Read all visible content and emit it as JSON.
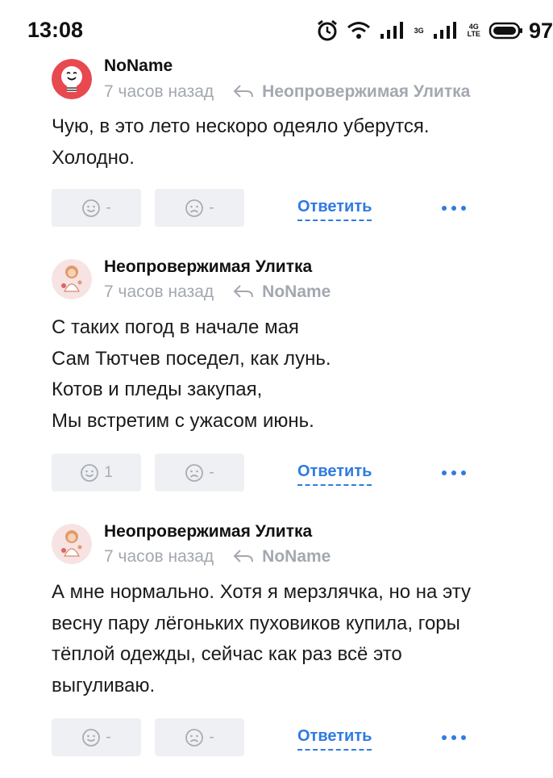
{
  "status_bar": {
    "time": "13:08",
    "network_3g": "3G",
    "network_4g_top": "4G",
    "network_4g_bottom": "LTE",
    "battery": "97"
  },
  "comments": [
    {
      "author": "NoName",
      "time": "7 часов назад",
      "reply_to": "Неопровержимая Улитка",
      "text": [
        "Чую, в это лето нескоро одеяло уберутся.",
        "Холодно."
      ],
      "likes": "-",
      "dislikes": "-",
      "reply_label": "Ответить"
    },
    {
      "author": "Неопровержимая Улитка",
      "time": "7 часов назад",
      "reply_to": "NoName",
      "text": [
        "С таких погод в начале мая",
        "Сам Тютчев поседел, как лунь.",
        "Котов и пледы закупая,",
        "Мы встретим с ужасом июнь."
      ],
      "likes": "1",
      "dislikes": "-",
      "reply_label": "Ответить"
    },
    {
      "author": "Неопровержимая Улитка",
      "time": "7 часов назад",
      "reply_to": "NoName",
      "text": [
        "А мне нормально. Хотя я мерзлячка, но на эту",
        "весну пару лёгоньких пуховиков купила, горы",
        "тёплой одежды, сейчас как раз всё это",
        "выгуливаю."
      ],
      "likes": "-",
      "dislikes": "-",
      "reply_label": "Ответить"
    }
  ]
}
